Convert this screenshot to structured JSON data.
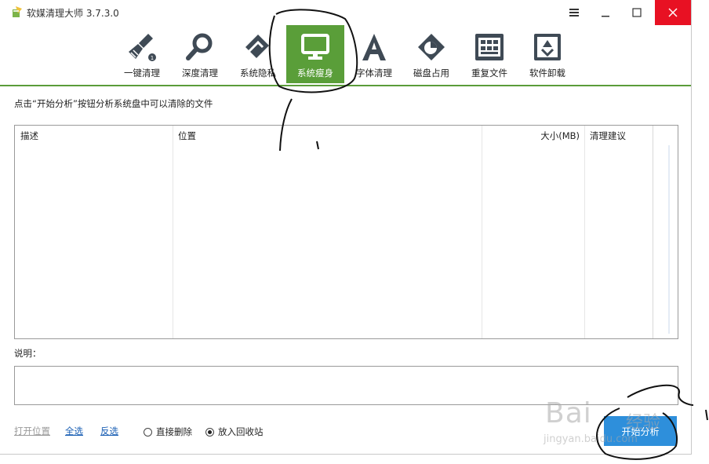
{
  "window": {
    "title": "软媒清理大师 3.7.3.0"
  },
  "titlebar": {
    "menu_icon": "menu-icon",
    "minimize_icon": "minimize-icon",
    "maximize_icon": "maximize-icon",
    "close_icon": "close-icon",
    "close_color": "#e81123"
  },
  "toolbar": {
    "accent": "#5a9e39",
    "items": [
      {
        "label": "一键清理",
        "icon": "broom-icon",
        "active": false
      },
      {
        "label": "深度清理",
        "icon": "magnifier-icon",
        "active": false
      },
      {
        "label": "系统隐私",
        "icon": "eraser-icon",
        "active": false
      },
      {
        "label": "系统瘦身",
        "icon": "monitor-icon",
        "active": true
      },
      {
        "label": "字体清理",
        "icon": "font-icon",
        "active": false
      },
      {
        "label": "磁盘占用",
        "icon": "disk-chart-icon",
        "active": false
      },
      {
        "label": "重复文件",
        "icon": "duplicate-files-icon",
        "active": false
      },
      {
        "label": "软件卸载",
        "icon": "recycle-icon",
        "active": false
      }
    ]
  },
  "main": {
    "hint": "点击“开始分析”按钮分析系统盘中可以清除的文件",
    "table": {
      "columns": [
        "描述",
        "位置",
        "大小(MB)",
        "清理建议"
      ]
    },
    "note_label": "说明：",
    "links": {
      "open_location": "打开位置",
      "select_all": "全选",
      "invert": "反选"
    },
    "radios": {
      "direct_delete": "直接删除",
      "recycle": "放入回收站",
      "selected": "recycle"
    },
    "start_button": "开始分析",
    "start_color": "#2e8fdb"
  },
  "watermark": {
    "line1": "Bai",
    "line2": "经验",
    "line3": "jingyan.baidu.com"
  }
}
